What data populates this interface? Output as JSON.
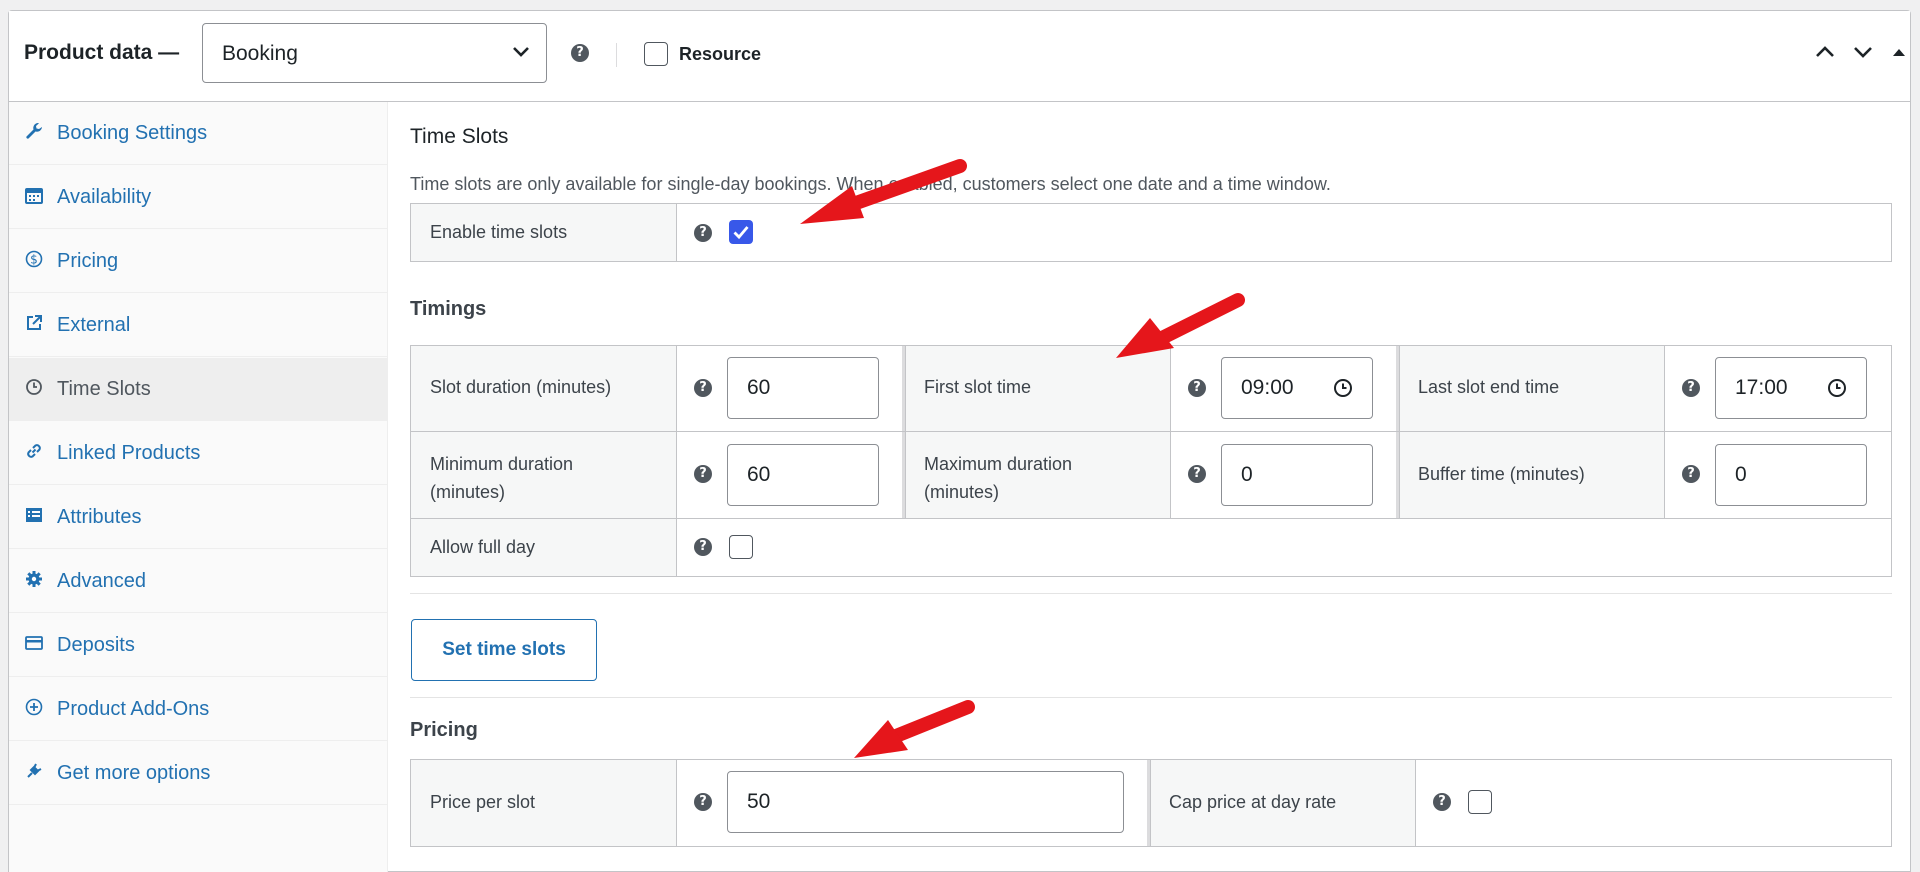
{
  "header": {
    "title": "Product data —",
    "product_type": "Booking",
    "resource_label": "Resource",
    "resource_checked": false
  },
  "sidebar": {
    "items": [
      {
        "label": "Booking Settings",
        "icon": "wrench-icon"
      },
      {
        "label": "Availability",
        "icon": "calendar-icon"
      },
      {
        "label": "Pricing",
        "icon": "dollar-icon"
      },
      {
        "label": "External",
        "icon": "external-link-icon"
      },
      {
        "label": "Time Slots",
        "icon": "clock-icon",
        "active": true
      },
      {
        "label": "Linked Products",
        "icon": "link-icon"
      },
      {
        "label": "Attributes",
        "icon": "list-icon"
      },
      {
        "label": "Advanced",
        "icon": "gear-icon"
      },
      {
        "label": "Deposits",
        "icon": "card-icon"
      },
      {
        "label": "Product Add-Ons",
        "icon": "plus-circle-icon"
      },
      {
        "label": "Get more options",
        "icon": "plugin-icon"
      }
    ]
  },
  "time_slots": {
    "title": "Time Slots",
    "description": "Time slots are only available for single-day bookings. When enabled, customers select one date and a time window.",
    "enable_label": "Enable time slots",
    "enable_checked": true
  },
  "timings": {
    "title": "Timings",
    "slot_duration_label": "Slot duration (minutes)",
    "slot_duration_value": "60",
    "first_slot_label": "First slot time",
    "first_slot_value": "09:00",
    "last_slot_label": "Last slot end time",
    "last_slot_value": "17:00",
    "min_duration_label_1": "Minimum duration",
    "min_duration_label_2": "(minutes)",
    "min_duration_value": "60",
    "max_duration_label_1": "Maximum duration",
    "max_duration_label_2": "(minutes)",
    "max_duration_value": "0",
    "buffer_label": "Buffer time (minutes)",
    "buffer_value": "0",
    "allow_full_day_label": "Allow full day",
    "allow_full_day_checked": false
  },
  "set_slots_button": "Set time slots",
  "pricing": {
    "title": "Pricing",
    "price_per_slot_label": "Price per slot",
    "price_per_slot_value": "50",
    "cap_label": "Cap price at day rate",
    "cap_checked": false
  },
  "colors": {
    "link": "#2271b1",
    "annotation_arrow": "#e5161b",
    "checkbox_checked": "#3858e9"
  }
}
